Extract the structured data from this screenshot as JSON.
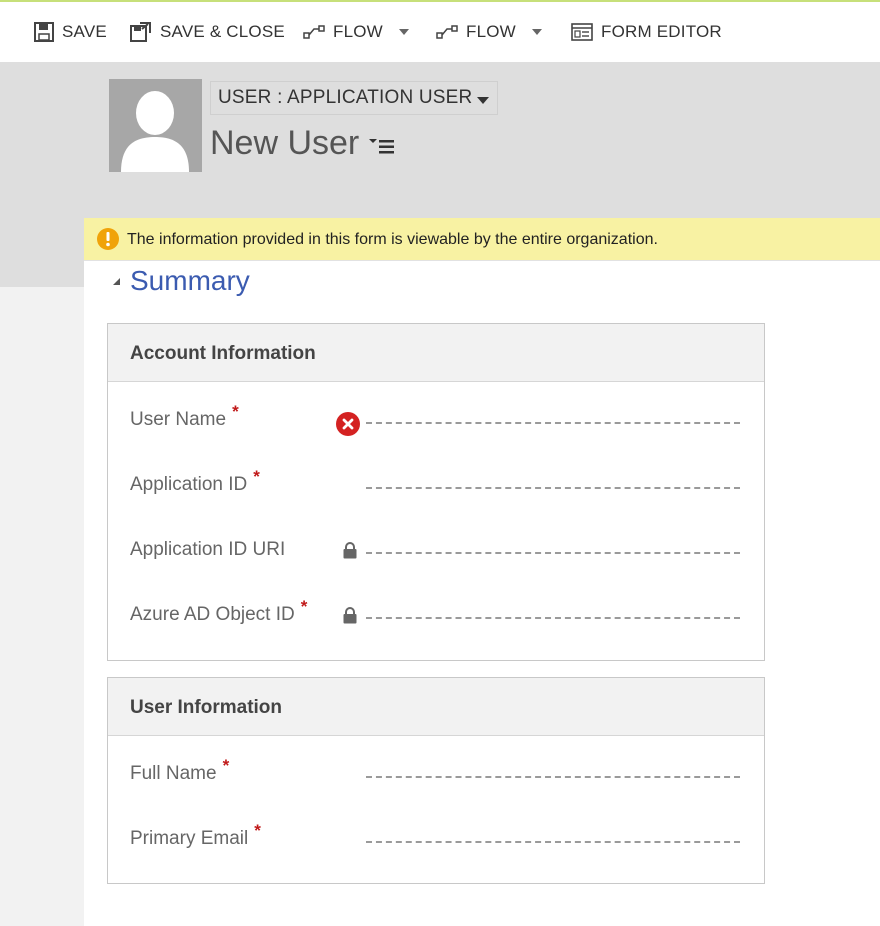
{
  "toolbar": {
    "save": "SAVE",
    "save_close": "SAVE & CLOSE",
    "flow1": "FLOW",
    "flow2": "FLOW",
    "form_editor": "FORM EDITOR"
  },
  "header": {
    "form_selector": "USER : APPLICATION USER",
    "record_name": "New User"
  },
  "notification": {
    "text": "The information provided in this form is viewable by the entire organization."
  },
  "summary": {
    "title": "Summary"
  },
  "account_section": {
    "title": "Account Information",
    "fields": [
      {
        "label": "User Name",
        "required_mark": "*",
        "status": "error",
        "value": ""
      },
      {
        "label": "Application ID",
        "required_mark": "*",
        "value": ""
      },
      {
        "label": "Application ID URI",
        "locked": true,
        "value": ""
      },
      {
        "label": "Azure AD Object ID",
        "required_mark": "*",
        "locked": true,
        "value": ""
      }
    ]
  },
  "user_section": {
    "title": "User Information",
    "fields": [
      {
        "label": "Full Name",
        "required_mark": "*",
        "value": ""
      },
      {
        "label": "Primary Email",
        "required_mark": "*",
        "value": ""
      }
    ]
  },
  "colors": {
    "notification_bg": "#f8f2a3",
    "summary_title": "#3b5bb0",
    "required": "#c01818",
    "error_icon": "#d42222",
    "warning_icon": "#f0a30a"
  },
  "icons": {
    "save": "floppy-disk-icon",
    "save_close": "save-close-icon",
    "flow": "flow-icon",
    "form_editor": "form-editor-icon",
    "notification": "warning-icon",
    "error": "error-icon",
    "locked": "lock-icon"
  }
}
